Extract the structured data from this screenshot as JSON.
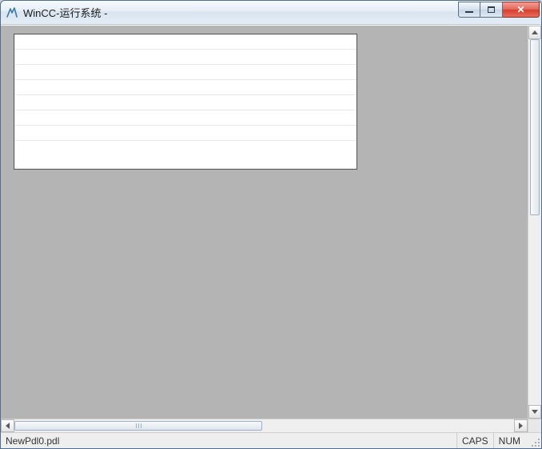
{
  "window": {
    "title": "WinCC-运行系统 -",
    "icon_name": "wincc-app-icon"
  },
  "controls": {
    "minimize_label": "Minimize",
    "maximize_label": "Maximize",
    "close_label": "Close"
  },
  "canvas": {
    "panel_rows": 8
  },
  "statusbar": {
    "filename": "NewPdl0.pdl",
    "caps": "CAPS",
    "num": "NUM"
  }
}
